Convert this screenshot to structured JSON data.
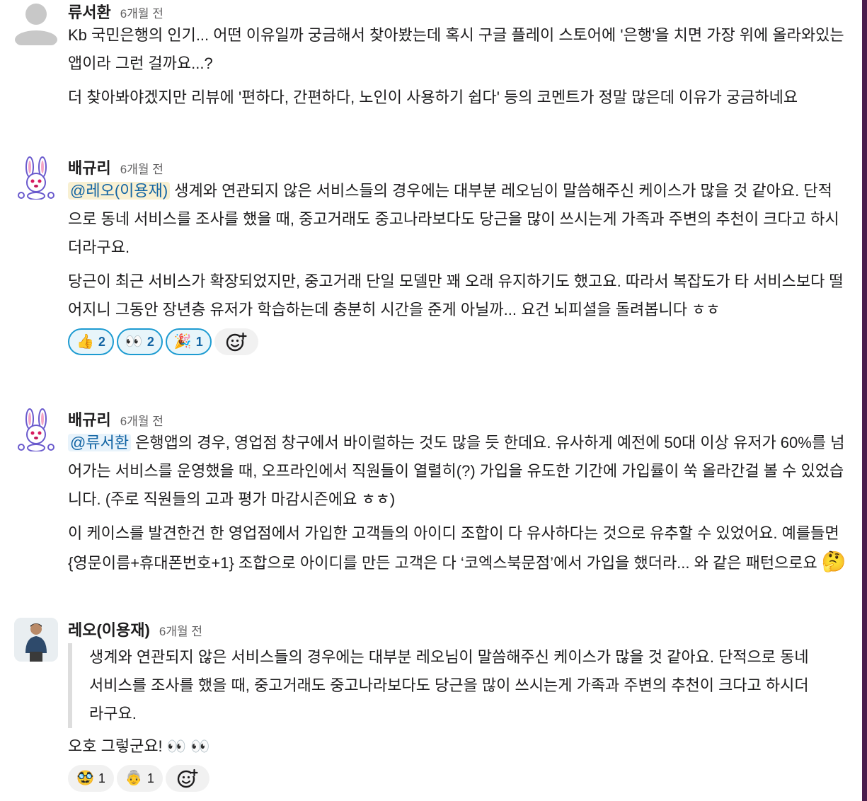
{
  "messages": [
    {
      "author": "류서환",
      "time": "6개월 전",
      "paragraphs": [
        "Kb 국민은행의 인기... 어떤 이유일까 궁금해서 찾아봤는데 혹시 구글 플레이 스토어에 '은행'을 치면 가장 위에 올라와있는 앱이라 그런 걸까요...?",
        "더 찾아봐야겠지만 리뷰에 '편하다, 간편하다, 노인이 사용하기 쉽다' 등의 코멘트가 정말 많은데 이유가 궁금하네요"
      ]
    },
    {
      "author": "배규리",
      "time": "6개월 전",
      "mention": "@레오(이용재)",
      "p1_rest": " 생계와 연관되지 않은 서비스들의 경우에는 대부분 레오님이 말씀해주신 케이스가 많을 것 같아요. 단적으로 동네 서비스를 조사를 했을 때, 중고거래도 중고나라보다도 당근을 많이 쓰시는게 가족과 주변의 추천이 크다고 하시더라구요.",
      "p2": "당근이 최근 서비스가 확장되었지만, 중고거래 단일 모델만 꽤 오래 유지하기도 했고요. 따라서 복잡도가 타 서비스보다 떨어지니 그동안 장년층 유저가 학습하는데 충분히 시간을 준게 아닐까... 요건 뇌피셜을 돌려봅니다 ㅎㅎ",
      "reactions": [
        {
          "emoji": "👍",
          "count": "2"
        },
        {
          "emoji": "👀",
          "count": "2"
        },
        {
          "emoji": "🎉",
          "count": "1"
        }
      ]
    },
    {
      "author": "배규리",
      "time": "6개월 전",
      "mention": "@류서환",
      "p1_rest": " 은행앱의 경우, 영업점 창구에서 바이럴하는 것도 많을 듯 한데요. 유사하게 예전에 50대 이상 유저가 60%를 넘어가는 서비스를 운영했을 때, 오프라인에서 직원들이 열렬히(?) 가입을 유도한 기간에 가입률이 쑥 올라간걸 볼 수 있었습니다. (주로 직원들의 고과 평가 마감시즌에요 ㅎㅎ)",
      "p2": "이 케이스를 발견한건 한 영업점에서 가입한 고객들의 아이디 조합이 다 유사하다는 것으로 유추할 수 있었어요. 예를들면 {영문이름+휴대폰번호+1} 조합으로 아이디를 만든 고객은 다 ‘코엑스북문점’에서 가입을 했더라... 와 같은 패턴으로요",
      "p2_emoji": "🤔"
    },
    {
      "author": "레오(이용재)",
      "time": "6개월 전",
      "quote": "생계와 연관되지 않은 서비스들의 경우에는 대부분 레오님이 말씀해주신 케이스가 많을 것 같아요. 단적으로 동네 서비스를 조사를 했을 때, 중고거래도 중고나라보다도 당근을 많이 쓰시는게 가족과 주변의 추천이 크다고 하시더라구요.",
      "text": "오호 그렇군요!",
      "text_emoji": "👀 👀",
      "reactions": [
        {
          "emoji": "🥸",
          "count": "1"
        },
        {
          "emoji": "👵",
          "count": "1"
        }
      ]
    }
  ]
}
